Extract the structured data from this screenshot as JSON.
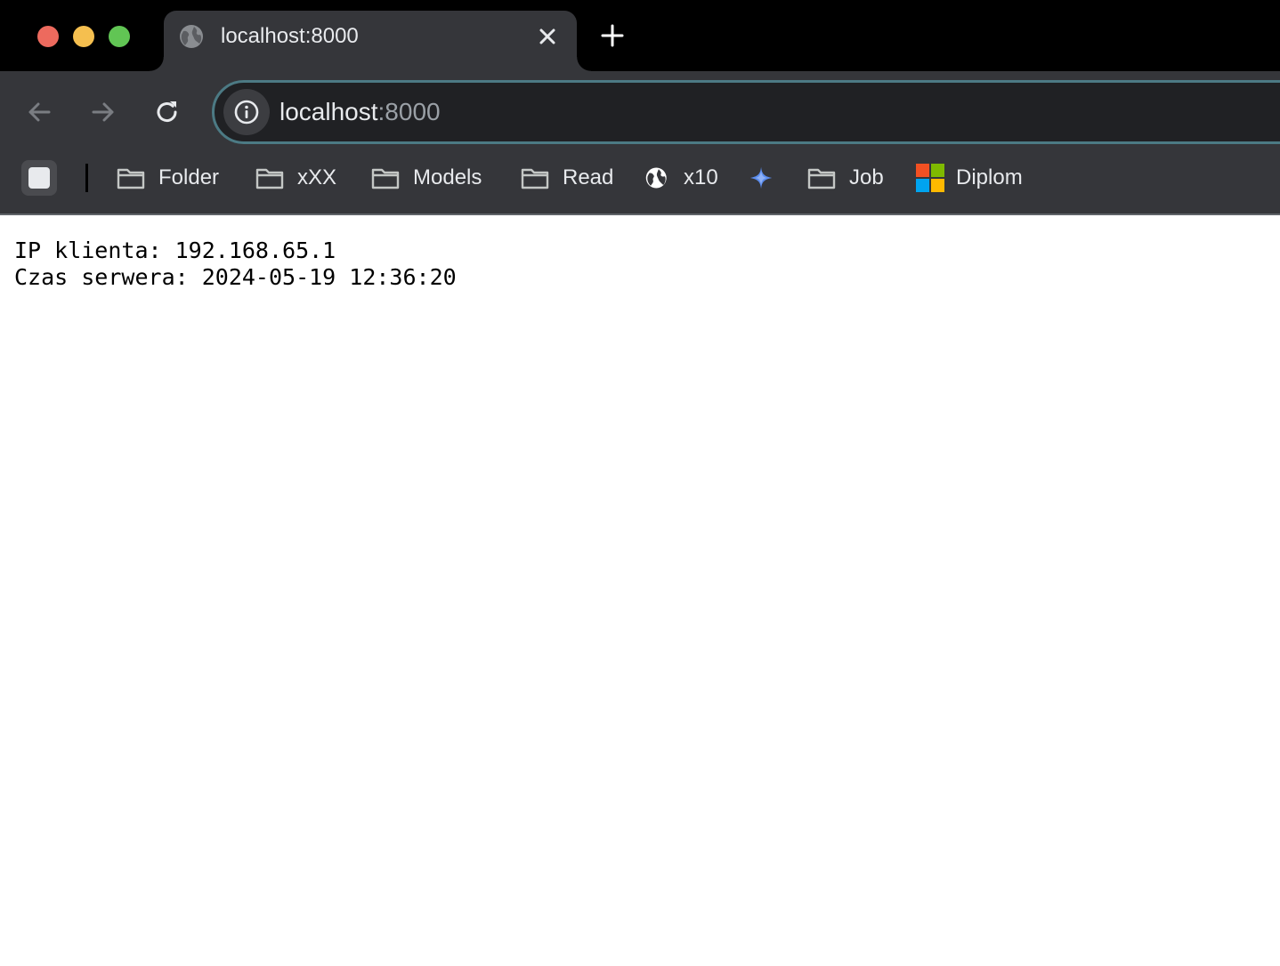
{
  "window": {
    "controls": [
      "close",
      "minimize",
      "maximize"
    ]
  },
  "tab": {
    "title": "localhost:8000",
    "favicon": "globe-icon"
  },
  "address_bar": {
    "host": "localhost",
    "port": ":8000",
    "accent": "#4c7a84"
  },
  "bookmarks": [
    {
      "label": "Folder",
      "icon": "folder-icon"
    },
    {
      "label": "xXX",
      "icon": "folder-icon"
    },
    {
      "label": "Models",
      "icon": "folder-icon"
    },
    {
      "label": "Read",
      "icon": "folder-icon"
    },
    {
      "label": "x10",
      "icon": "globe-icon"
    },
    {
      "label": "",
      "icon": "sparkle-icon"
    },
    {
      "label": "Job",
      "icon": "folder-icon"
    },
    {
      "label": "Diplom",
      "icon": "microsoft-logo-icon"
    }
  ],
  "page": {
    "lines": [
      "IP klienta: 192.168.65.1",
      "Czas serwera: 2024-05-19 12:36:20"
    ]
  }
}
